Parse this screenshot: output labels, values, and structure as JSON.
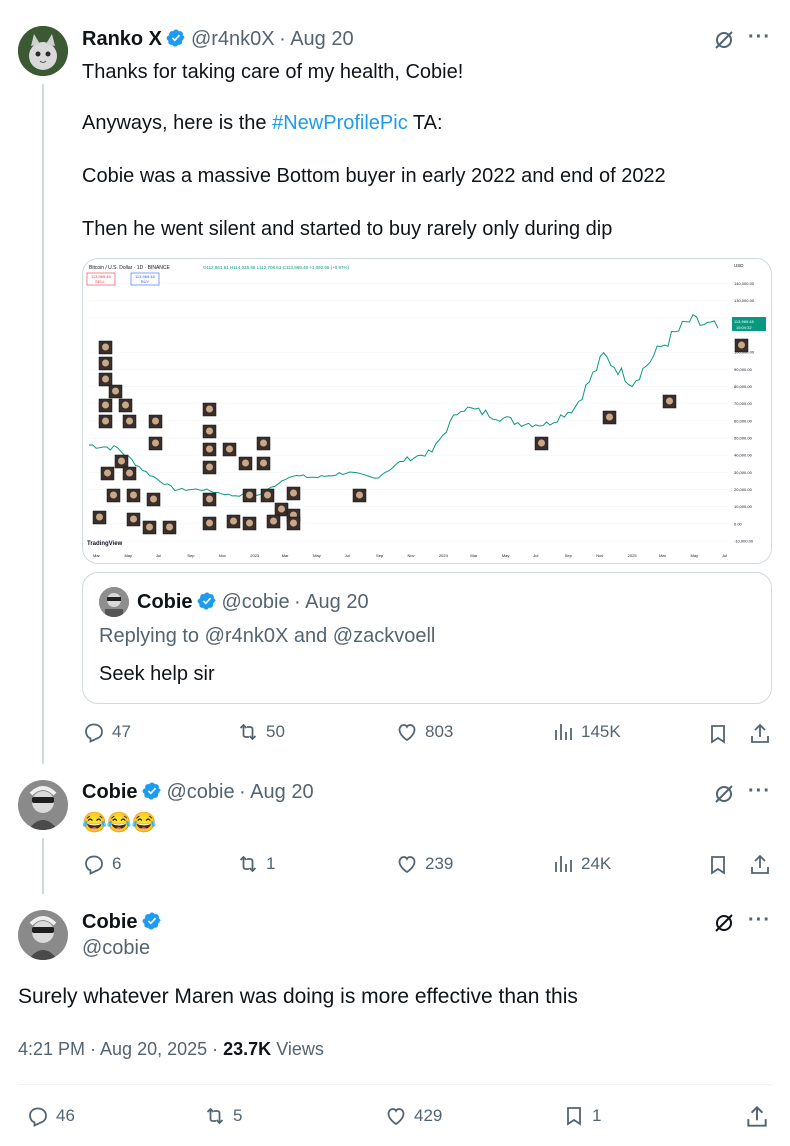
{
  "tweet1": {
    "name": "Ranko X",
    "handle": "@r4nk0X",
    "date": "Aug 20",
    "line1": "Thanks for taking care of my health, Cobie!",
    "line2_pre": "Anyways, here is the ",
    "line2_tag": "#NewProfilePic",
    "line2_post": " TA:",
    "line3": "Cobie was a massive Bottom buyer in early 2022 and end of 2022",
    "line4": "Then he went silent and started to buy rarely only during dip",
    "stats": {
      "replies": "47",
      "reposts": "50",
      "likes": "803",
      "views": "145K"
    }
  },
  "quote": {
    "name": "Cobie",
    "handle": "@cobie",
    "date": "Aug 20",
    "reply_to": "Replying to @r4nk0X and @zackvoell",
    "text": "Seek help sir"
  },
  "tweet2": {
    "name": "Cobie",
    "handle": "@cobie",
    "date": "Aug 20",
    "text": "😂😂😂",
    "stats": {
      "replies": "6",
      "reposts": "1",
      "likes": "239",
      "views": "24K"
    }
  },
  "main": {
    "name": "Cobie",
    "handle": "@cobie",
    "text": "Surely whatever Maren was doing is more effective than this",
    "time": "4:21 PM · Aug 20, 2025 · ",
    "views_count": "23.7K",
    "views_label": " Views",
    "stats": {
      "replies": "46",
      "reposts": "5",
      "likes": "429",
      "bookmarks": "1"
    }
  },
  "chart_data": {
    "type": "line",
    "title": "Bitcoin / U.S. Dollar · 1D · BINANCE",
    "ohlc_text": "O112,861.81 H114,025.85 L112,708.63 C113,969.48 +1,092.65 (+0.97%)",
    "sell_price": "113,969.48",
    "sell_label": "SELL",
    "buy_price": "113,969.48",
    "buy_label": "BUY",
    "currency": "USD",
    "watermark": "TradingView",
    "price_tag": "113,969.48",
    "price_tag_sub": "15:04:32",
    "y_ticks": [
      "140,000.00",
      "130,000.00",
      "120,000.00",
      "100,000.00",
      "90,000.00",
      "80,000.00",
      "70,000.00",
      "60,000.00",
      "50,000.00",
      "40,000.00",
      "30,000.00",
      "20,000.00",
      "10,000.00",
      "0.00",
      "-10,000.00"
    ],
    "x_ticks": [
      "Mar",
      "May",
      "Jul",
      "Sep",
      "Nov",
      "2023",
      "Mar",
      "May",
      "Jul",
      "Sep",
      "Nov",
      "2024",
      "Mar",
      "May",
      "Jul",
      "Sep",
      "Nov",
      "2025",
      "Mar",
      "May",
      "Jul"
    ],
    "x": [
      "2022-01",
      "2022-03",
      "2022-05",
      "2022-07",
      "2022-09",
      "2022-11",
      "2023-01",
      "2023-03",
      "2023-05",
      "2023-07",
      "2023-09",
      "2023-11",
      "2024-01",
      "2024-03",
      "2024-05",
      "2024-07",
      "2024-09",
      "2024-11",
      "2025-01",
      "2025-03",
      "2025-05",
      "2025-07",
      "2025-08"
    ],
    "values": [
      46000,
      44000,
      30000,
      20000,
      20000,
      16500,
      17000,
      28000,
      27000,
      30000,
      26500,
      37000,
      42000,
      68000,
      64000,
      59000,
      58000,
      68000,
      98000,
      82000,
      103000,
      118000,
      113969
    ],
    "ylim": [
      -10000,
      145000
    ]
  }
}
